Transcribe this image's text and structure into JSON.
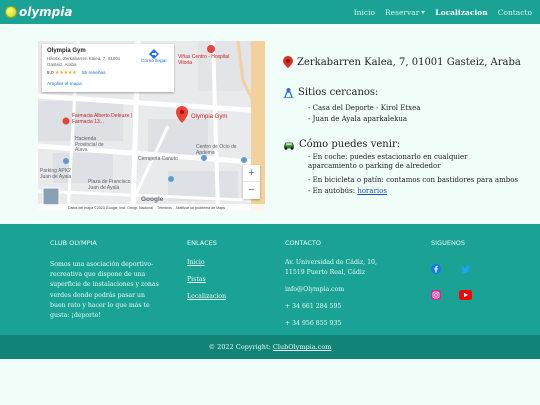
{
  "nav": {
    "brand": "olympia",
    "links": [
      "Inicio",
      "Reservar",
      "Localizacion",
      "Contacto"
    ],
    "active": "Localizacion"
  },
  "map": {
    "place_name": "Olympia Gym",
    "place_address": "Hiketxi, Zerkabarren Kalea, 7, 01001 Gasteiz, Araba",
    "rating": "5,0",
    "stars": "★★★★★",
    "reviews": "55 reseñas",
    "more_map": "Ampliar el mapa",
    "directions": "Cómo llegar",
    "labels": {
      "villas": "Viñas Centro - Hospital Vitoria",
      "pharmacy": "Farmacia Alberto Deleuze | Farmacia 13...",
      "gym": "Olympia Gym",
      "hacienda": "Hacienda Provincial de Álava",
      "ocio": "Centro de Ocio de Apdema",
      "cerrajeria": "Cerrajería Canuto",
      "parking": "Parking APK2 Juan de Ayala",
      "plaza": "Plaza de Francisco Juan de Ayala"
    },
    "footer_items": [
      "Datos del mapa ©2023 Google, Inst. Geogr. Nacional",
      "Términos",
      "Notificar un problema de Maps"
    ],
    "google_logo": "Google",
    "zoom_in": "+",
    "zoom_out": "−"
  },
  "location": {
    "address": "Zerkabarren Kalea, 7, 01001 Gasteiz, Araba",
    "nearby_title": "Sitios cercanos:",
    "nearby": [
      "- Casa del Deporte - Kirol Etxea",
      "- Juan de Ayala aparkalekua"
    ],
    "how_title": "Cómo puedes venir:",
    "how_car": "- En coche: puedes estacionarlo en cualquier aparcamiento o parking de alrededor",
    "how_bike": "- En bicicleta o patín: contamos con bastidores para ambos",
    "how_bus_prefix": "- En autobús:",
    "how_bus_link": "horarios"
  },
  "footer": {
    "club_title": "CLUB OLYMPIA",
    "club_text": "Somos una asociación deportivo-recreativa que dispone de una superficie de instalaciones y zonas verdes donde podrás pasar un buen rato y hacer lo que más te gusta: ¡deporte!",
    "links_title": "ENLACES",
    "links": [
      "Inicio",
      "Pistas",
      "Localizacion"
    ],
    "contact_title": "CONTACTO",
    "contact_address": "Av. Universidad de Cádiz, 10, 11519 Puerto Real, Cádiz",
    "contact_email": "info@Olympia.com",
    "contact_phone1": "+ 34 661 284 595",
    "contact_phone2": "+ 34 956 855 935",
    "follow_title": "SIGUENOS",
    "copyright_prefix": "© 2022 Copyright:",
    "copyright_link": "ClubOlympia.com"
  },
  "colors": {
    "primary": "#1aa395",
    "dark": "#118377",
    "background": "#f0fdf8"
  }
}
